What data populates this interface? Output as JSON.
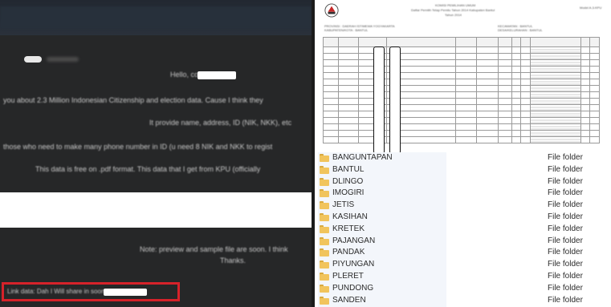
{
  "forum": {
    "top_pill": "···",
    "lines": [
      "Hello,                 community.",
      "you about 2.3 Million Indonesian Citizenship and election data. Cause I think they",
      "It provide name, address, ID (NIK, NKK), etc",
      "those who need to make many phone number in ID (u need 8 NIK and NKK to regist",
      "This data is free on .pdf format. This data that I get from KPU (officially",
      "Note: preview and sample file are soon. I think",
      "Thanks."
    ],
    "highlight_text": "Link data: Dah I Will share in                    soon"
  },
  "document": {
    "header_lines": [
      "KOMISI PEMILIHAN UMUM",
      "Daftar Pemilih Tetap Pemilu Tahun 2014 Kabupaten Bantul",
      "Tahun 2014"
    ],
    "side_header": "Model A.3-KPU",
    "meta_left": [
      "PROVINSI : DAERAH ISTIMEWA YOGYAKARTA",
      "KABUPATEN/KOTA : BANTUL"
    ],
    "meta_right": [
      "KECAMATAN : BANTUL",
      "DESA/KELURAHAN : BANTUL"
    ]
  },
  "folders": {
    "items": [
      {
        "name": "BANGUNTAPAN",
        "type": "File folder"
      },
      {
        "name": "BANTUL",
        "type": "File folder"
      },
      {
        "name": "DLINGO",
        "type": "File folder"
      },
      {
        "name": "IMOGIRI",
        "type": "File folder"
      },
      {
        "name": "JETIS",
        "type": "File folder"
      },
      {
        "name": "KASIHAN",
        "type": "File folder"
      },
      {
        "name": "KRETEK",
        "type": "File folder"
      },
      {
        "name": "PAJANGAN",
        "type": "File folder"
      },
      {
        "name": "PANDAK",
        "type": "File folder"
      },
      {
        "name": "PIYUNGAN",
        "type": "File folder"
      },
      {
        "name": "PLERET",
        "type": "File folder"
      },
      {
        "name": "PUNDONG",
        "type": "File folder"
      },
      {
        "name": "SANDEN",
        "type": "File folder"
      }
    ]
  },
  "colors": {
    "forum_bg": "#262728",
    "highlight_border": "#d6222a",
    "folder_icon": "#f1c45c"
  }
}
